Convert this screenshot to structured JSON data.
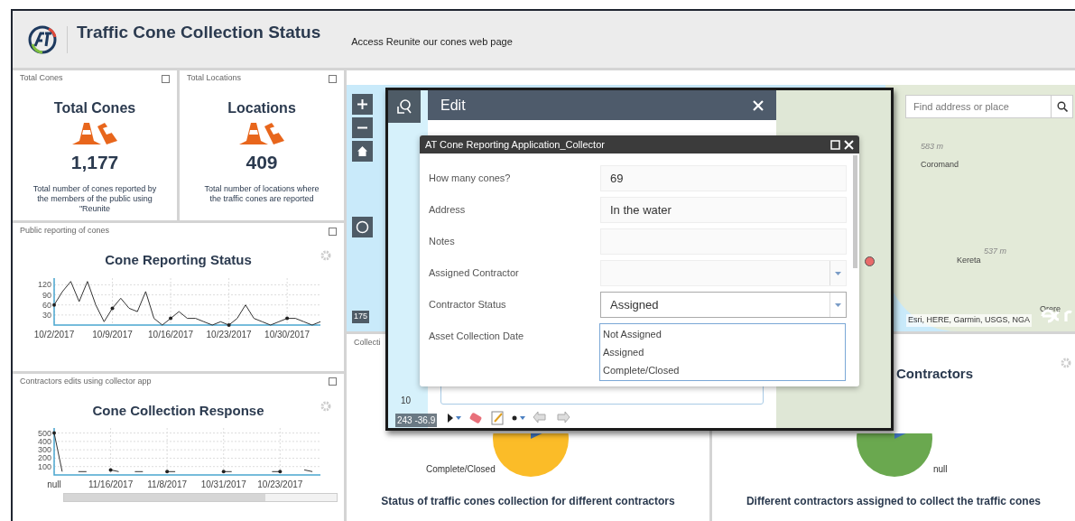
{
  "header": {
    "title": "Traffic Cone Collection Status",
    "link": "Access Reunite our cones web page"
  },
  "indicators": [
    {
      "caption": "Total Cones",
      "title": "Total Cones",
      "value": "1,177",
      "description": "Total number of cones reported by the members of the public using  \"Reunite"
    },
    {
      "caption": "Total Locations",
      "title": "Locations",
      "value": "409",
      "description": "Total  number of locations where the traffic cones are reported"
    }
  ],
  "line_panels": [
    {
      "caption": "Public reporting of cones",
      "title": "Cone Reporting Status",
      "scrollbar": false,
      "chart_data": {
        "type": "line",
        "categories": [
          "10/2/2017",
          null,
          null,
          null,
          null,
          null,
          null,
          "10/9/2017",
          null,
          null,
          null,
          null,
          null,
          null,
          "10/16/2017",
          null,
          null,
          null,
          null,
          null,
          null,
          "10/23/2017",
          null,
          null,
          null,
          null,
          null,
          null,
          "10/30/2017",
          null,
          null,
          null,
          null
        ],
        "series": [
          {
            "color": "#333333",
            "values": [
              60,
              100,
              130,
              70,
              130,
              60,
              10,
              50,
              80,
              50,
              40,
              100,
              20,
              0,
              20,
              40,
              20,
              20,
              10,
              0,
              10,
              0,
              20,
              60,
              20,
              10,
              0,
              10,
              20,
              20,
              10,
              0,
              10
            ]
          }
        ],
        "ylim": [
          0,
          140
        ],
        "yticks": [
          30,
          60,
          90,
          120
        ],
        "grid": true
      }
    },
    {
      "caption": "Contractors edits using collector app",
      "title": "Cone Collection Response",
      "scrollbar": true,
      "chart_data": {
        "type": "line",
        "categories": [
          "null",
          null,
          null,
          null,
          null,
          null,
          null,
          "11/16/2017",
          null,
          null,
          null,
          null,
          null,
          null,
          "11/8/2017",
          null,
          null,
          null,
          null,
          null,
          null,
          "10/31/2017",
          null,
          null,
          null,
          null,
          null,
          null,
          "10/23/2017",
          null,
          null,
          null,
          null,
          null
        ],
        "series": [
          {
            "color": "#333333",
            "values": [
              500,
              40,
              null,
              40,
              40,
              null,
              null,
              60,
              40,
              null,
              40,
              40,
              null,
              null,
              40,
              40,
              null,
              null,
              null,
              null,
              null,
              40,
              40,
              null,
              null,
              null,
              null,
              40,
              40,
              null,
              null,
              60,
              40,
              null
            ]
          }
        ],
        "ylim": [
          0,
          560
        ],
        "yticks": [
          100,
          200,
          300,
          400,
          500
        ],
        "grid": true
      }
    }
  ],
  "map": {
    "search_placeholder": "Find address or place",
    "labels": [
      {
        "text": "583 m",
        "kind": "elevation"
      },
      {
        "text": "Coromand",
        "kind": "place"
      },
      {
        "text": "537 m",
        "kind": "elevation"
      },
      {
        "text": "Kereta",
        "kind": "place"
      },
      {
        "text": "Orere",
        "kind": "place"
      }
    ],
    "attribution": "Esri, HERE, Garmin, USGS, NGA",
    "scale": "175"
  },
  "pie_panels": [
    {
      "caption": "Collecti",
      "slice_label": "Complete/Closed",
      "footer": "Status of traffic cones collection for different contractors"
    },
    {
      "title": "Contractors",
      "slice_label": "null",
      "footer": "Different contractors assigned to collect the traffic cones"
    }
  ],
  "edit_window": {
    "title": "Edit",
    "coords": "243 -36.9",
    "scale_label": "10",
    "form": {
      "title": "AT Cone Reporting Application_Collector",
      "fields": [
        {
          "label": "How many cones?",
          "value": "69",
          "kind": "text"
        },
        {
          "label": "Address",
          "value": "In the water",
          "kind": "text"
        },
        {
          "label": "Notes",
          "kind": "text"
        },
        {
          "label": "Assigned Contractor",
          "kind": "select",
          "open": false
        },
        {
          "label": "Contractor Status",
          "value": "Assigned",
          "kind": "select",
          "open": true
        },
        {
          "label": "Asset Collection Date",
          "kind": "none"
        }
      ],
      "options": [
        "Not Assigned",
        "Assigned",
        "Complete/Closed"
      ]
    }
  }
}
